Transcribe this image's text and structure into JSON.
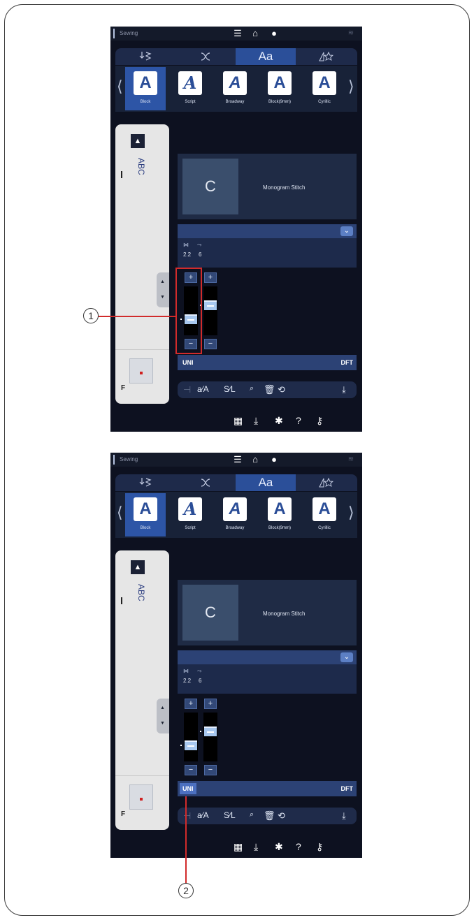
{
  "screen": {
    "status_title": "Sewing",
    "category_tabs": [
      "",
      "",
      "Aa",
      ""
    ],
    "fonts": [
      {
        "glyph": "A",
        "label": "Block"
      },
      {
        "glyph": "A",
        "label": "Script"
      },
      {
        "glyph": "A",
        "label": "Broadway"
      },
      {
        "glyph": "A",
        "label": "Block(9mm)"
      },
      {
        "glyph": "A",
        "label": "Cyrillic"
      }
    ],
    "text_preview": "ABC",
    "pattern_letter": "C",
    "pattern_name": "Monogram Stitch",
    "width_value": "2.2",
    "length_value": "6",
    "plus": "+",
    "minus": "−",
    "uni_label": "UNI",
    "dft_label": "DFT",
    "foot_label": "F",
    "toolbar": {
      "aA": "a⁄A",
      "sL": "S⁄L"
    }
  },
  "callouts": {
    "one": "1",
    "two": "2"
  },
  "colors": {
    "accent": "#2b4f99",
    "highlight": "#d12b2b",
    "uni_active": "#4c70c0"
  }
}
